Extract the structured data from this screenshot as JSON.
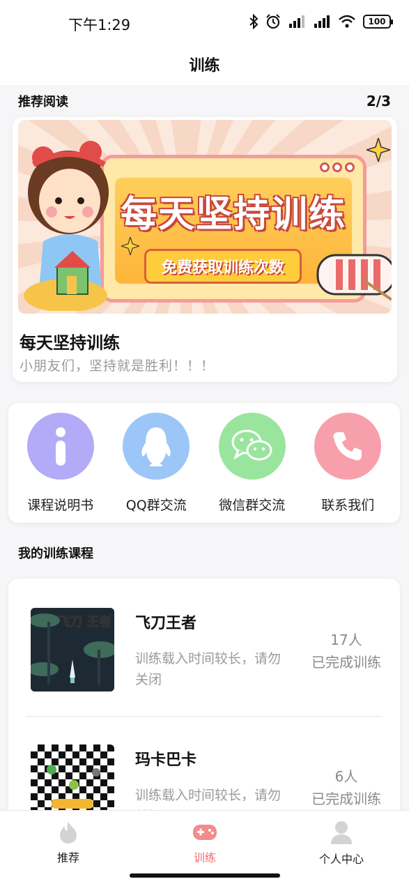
{
  "status_bar": {
    "time": "下午1:29",
    "battery": "100"
  },
  "header": {
    "title": "训练"
  },
  "recommend": {
    "section_title": "推荐阅读",
    "page_indicator": "2/3",
    "banner": {
      "headline": "每天坚持训练",
      "pill": "免费获取训练次数"
    },
    "title": "每天坚持训练",
    "subtitle": "小朋友们，坚持就是胜利！！！"
  },
  "quick_actions": [
    {
      "label": "课程说明书",
      "icon": "info-icon",
      "color": "#b3abf7"
    },
    {
      "label": "QQ群交流",
      "icon": "qq-penguin-icon",
      "color": "#9cc6f7"
    },
    {
      "label": "微信群交流",
      "icon": "wechat-icon",
      "color": "#9ae59e"
    },
    {
      "label": "联系我们",
      "icon": "phone-icon",
      "color": "#f7a0ab"
    }
  ],
  "courses": {
    "section_title": "我的训练课程",
    "items": [
      {
        "name": "飞刀王者",
        "desc": "训练载入时间较长，请勿关闭",
        "count": "17人",
        "status": "已完成训练",
        "thumb_text": "飞刀 王者"
      },
      {
        "name": "玛卡巴卡",
        "desc": "训练载入时间较长，请勿关闭",
        "count": "6人",
        "status": "已完成训练"
      }
    ]
  },
  "tabbar": {
    "tabs": [
      {
        "label": "推荐",
        "icon": "flame-icon"
      },
      {
        "label": "训练",
        "icon": "gamepad-icon",
        "active": true
      },
      {
        "label": "个人中心",
        "icon": "user-icon"
      }
    ],
    "active_color": "#f06b6b"
  }
}
